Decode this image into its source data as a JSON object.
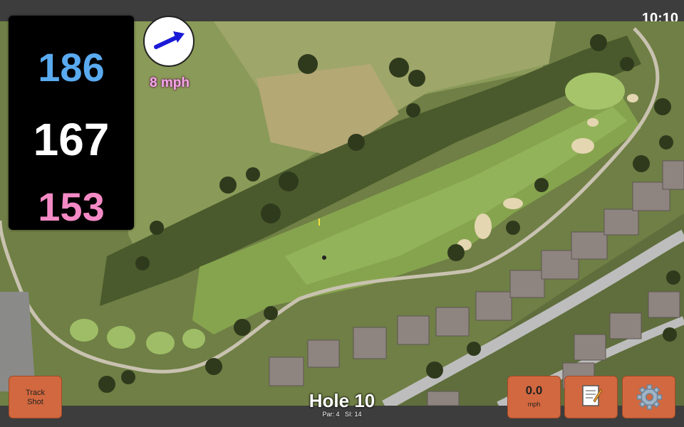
{
  "status_bar": {
    "time": "10:10"
  },
  "yardages": {
    "back": "186",
    "center": "167",
    "front": "153"
  },
  "wind": {
    "speed_label": "8 mph",
    "arrow_icon": "arrow-right-icon"
  },
  "controls": {
    "track_shot_line1": "Track",
    "track_shot_line2": "Shot",
    "wind_value": "0.0",
    "wind_unit": "mph",
    "notes_icon": "memo-icon",
    "settings_icon": "gear-icon"
  },
  "hole": {
    "title": "Hole 10",
    "par_label": "Par: 4",
    "si_label": "SI: 14"
  },
  "colors": {
    "back": "#5aaaf0",
    "center": "#ffffff",
    "front": "#f48ac5",
    "button": "#d2683f",
    "wind_speed": "#f4a7e7"
  }
}
